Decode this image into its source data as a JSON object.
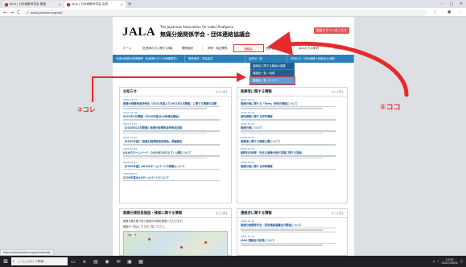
{
  "browser": {
    "tabs": [
      {
        "title": "JALA | 日本麻酔科学会 看護"
      },
      {
        "title": "JALA | 日本麻酔科学会 会員"
      }
    ],
    "url": "www.jalasite.org/oal/",
    "icons": {
      "back": "←",
      "forward": "→",
      "reload": "C",
      "new_tab": "+",
      "minimize": "–",
      "maximize": "□",
      "close": "✕"
    }
  },
  "site": {
    "logo": "JALA",
    "subtitle_en": "The Japanese Association for Labor Analgesia",
    "title_jp": "無痛分娩関係学会・団体連絡協議会",
    "login_label": "会員ログインはこちら",
    "main_menu": [
      {
        "label": "ホーム"
      },
      {
        "label": "妊産婦の方に関する情報"
      },
      {
        "label": "関係施設"
      },
      {
        "label": "研修・検定関係"
      },
      {
        "label": "連絡会"
      },
      {
        "label": "医療者に関する情報"
      },
      {
        "label": "JALAからの案内"
      },
      {
        "label": "お問合せ"
      }
    ],
    "sub_menu": [
      {
        "label": "分娩の無痛分娩情報等（妊産婦の方への情報提供）"
      },
      {
        "label": "関係団体・学会会員"
      },
      {
        "label": "会員の一覧"
      },
      {
        "label": "お知らせ（日本産婦人科医会の活動）"
      }
    ],
    "dropdown": [
      {
        "label": "連絡会に関する取組の実績"
      },
      {
        "label": "連絡会一覧・地域"
      },
      {
        "label": "連絡会一覧（リスト）"
      }
    ]
  },
  "panels": {
    "news": {
      "title": "お知らせ",
      "more": "もっと見る",
      "items": [
        {
          "date": "2021.02.23",
          "title": "無痛分娩関係者研修会（2021年度より2021年2月開催）に関する情報の記載"
        },
        {
          "date": "2021.01.18",
          "title": "2021年2月開催（2020年度JALA研修会開始）"
        },
        {
          "date": "2020.12.15",
          "title": "【2020年12月開催】無痛分娩関係者研修会記録"
        },
        {
          "date": "2020.11.30",
          "title": "【2020年度】「無痛分娩関係者研修会」開催報告"
        },
        {
          "date": "2020.10.02",
          "title": "JALAのホームページ（2020年10月より）公開について"
        },
        {
          "date": "2020.09.15",
          "title": "【2020年度】JALAのホームページの掲載について"
        },
        {
          "date": "2020.08.01",
          "title": "2020年度JALAホームページについて"
        }
      ]
    },
    "medical": {
      "title": "医療者に関する情報",
      "more": "もっと見る",
      "items": [
        {
          "date": "2021.02.10",
          "title": "無痛分娩に関する「Web」研修の開催について"
        },
        {
          "date": "2021.01.22",
          "title": "産科麻酔に関する研究情報"
        },
        {
          "date": "2020.12.24",
          "title": "無痛分娩について"
        },
        {
          "date": "2020.11.05",
          "title": "医療者に関する情報公開について"
        },
        {
          "date": "2020.10.15",
          "title": "麻酔科の研修・安全な無痛分娩の実施に関する取組"
        },
        {
          "date": "2020.09.01",
          "title": "無痛分娩に関する研修情報"
        }
      ]
    },
    "facilities": {
      "title": "無痛分娩取扱施設・検索に関する情報",
      "more": "もっと見る",
      "lines": [
        "無痛分娩を取り扱う施設の情報を検索いただけます。",
        "施設の一覧はこちらをご覧ください。"
      ],
      "map_label": "施設一覧"
    },
    "council": {
      "title": "連絡会に関する情報",
      "more": "もっと見る",
      "items": [
        {
          "date": "2021.02.15",
          "title": "無痛分娩関係学会・団体連絡協議会の開催について"
        },
        {
          "date": "2021.01.10",
          "title": "JALA 連絡会の記録について"
        }
      ]
    }
  },
  "annotations": {
    "one": "①ココ",
    "two": "②コレ",
    "color": "#e52b2b"
  },
  "status_url": "https://www.jalasite.org/oal/news/list",
  "taskbar": {
    "search_placeholder": "ここに入力して検索",
    "time": "14:32",
    "date": "2021/03/02"
  }
}
